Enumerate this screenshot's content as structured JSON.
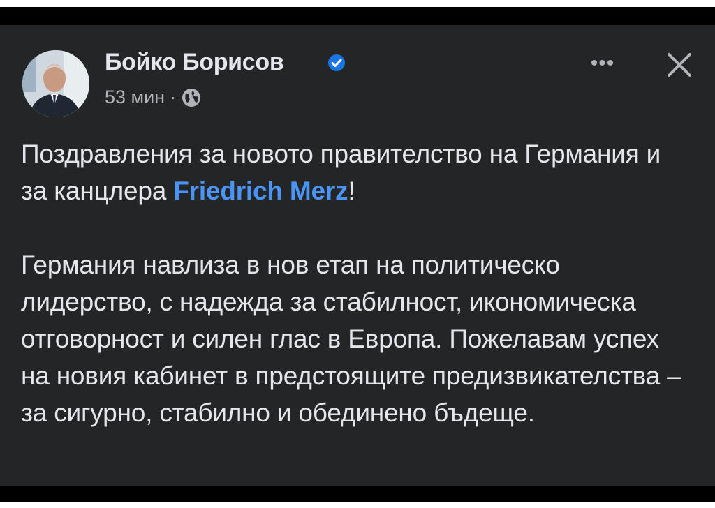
{
  "post": {
    "author_name": "Бойко Борисов",
    "timestamp": "53 мин",
    "separator": "·",
    "paragraph1_before": "Поздравления за новото правителство на Германия и за канцлера ",
    "mention": "Friedrich Merz",
    "paragraph1_after": "!",
    "paragraph2": "Германия навлиза в нов етап на политическо лидерство, с надежда за стабилност, икономическа отговорност и силен глас в Европа. Пожелавам успех на новия кабинет в предстоящите предизвикателства – за сигурно, стабилно и обединено бъдеще."
  },
  "icons": {
    "verified": "verified-badge-icon",
    "audience": "globe-icon",
    "more": "more-options-icon",
    "close": "close-icon"
  },
  "colors": {
    "background": "#242526",
    "text": "#e4e6eb",
    "secondary_text": "#b0b3b8",
    "mention": "#4a94f5",
    "verified_badge": "#1b74e4"
  }
}
